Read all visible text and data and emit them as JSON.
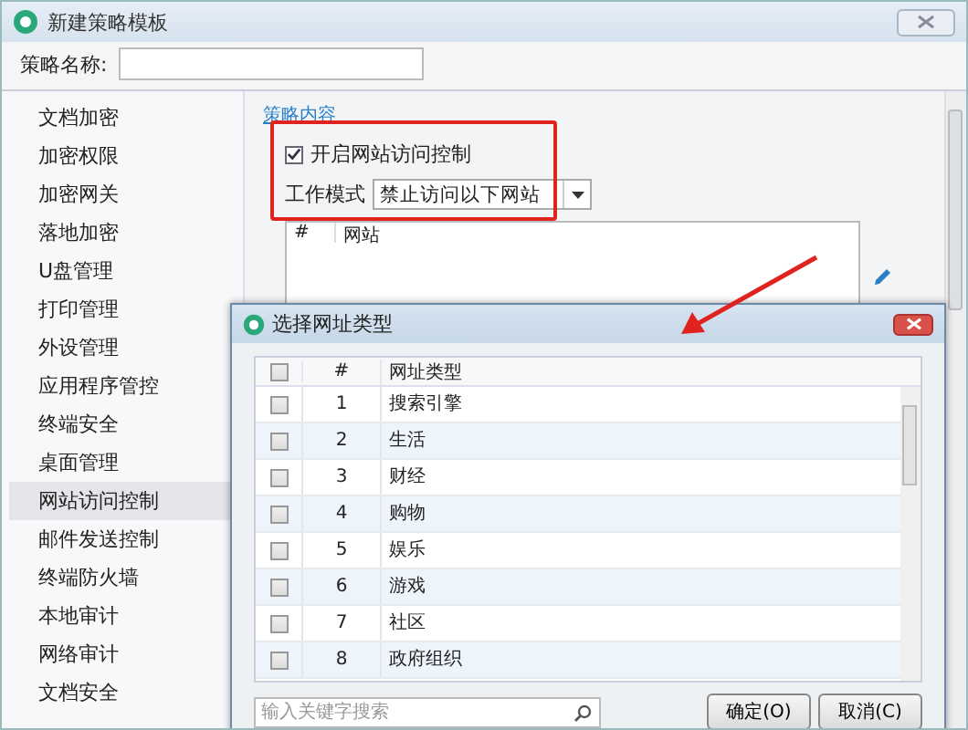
{
  "window": {
    "title": "新建策略模板"
  },
  "name_field": {
    "label": "策略名称:"
  },
  "sidebar": {
    "items": [
      {
        "label": "文档加密",
        "selected": false
      },
      {
        "label": "加密权限",
        "selected": false
      },
      {
        "label": "加密网关",
        "selected": false
      },
      {
        "label": "落地加密",
        "selected": false
      },
      {
        "label": "U盘管理",
        "selected": false
      },
      {
        "label": "打印管理",
        "selected": false
      },
      {
        "label": "外设管理",
        "selected": false
      },
      {
        "label": "应用程序管控",
        "selected": false
      },
      {
        "label": "终端安全",
        "selected": false
      },
      {
        "label": "桌面管理",
        "selected": false
      },
      {
        "label": "网站访问控制",
        "selected": true
      },
      {
        "label": "邮件发送控制",
        "selected": false
      },
      {
        "label": "终端防火墙",
        "selected": false
      },
      {
        "label": "本地审计",
        "selected": false
      },
      {
        "label": "网络审计",
        "selected": false
      },
      {
        "label": "文档安全",
        "selected": false
      }
    ]
  },
  "content": {
    "section_link": "策略内容",
    "enable": {
      "label": "开启网站访问控制",
      "checked": true
    },
    "work_mode": {
      "label": "工作模式",
      "value": "禁止访问以下网站"
    },
    "site_table": {
      "columns": [
        "#",
        "网站"
      ]
    }
  },
  "dialog": {
    "title": "选择网址类型",
    "header_checked": false,
    "columns": [
      "#",
      "网址类型"
    ],
    "rows": [
      {
        "number": "1",
        "name": "搜索引擎",
        "checked": false
      },
      {
        "number": "2",
        "name": "生活",
        "checked": false
      },
      {
        "number": "3",
        "name": "财经",
        "checked": false
      },
      {
        "number": "4",
        "name": "购物",
        "checked": false
      },
      {
        "number": "5",
        "name": "娱乐",
        "checked": false
      },
      {
        "number": "6",
        "name": "游戏",
        "checked": false
      },
      {
        "number": "7",
        "name": "社区",
        "checked": false
      },
      {
        "number": "8",
        "name": "政府组织",
        "checked": false
      }
    ],
    "search": {
      "placeholder": "输入关键字搜索"
    },
    "buttons": [
      "确定(O)",
      "取消(C)"
    ]
  }
}
